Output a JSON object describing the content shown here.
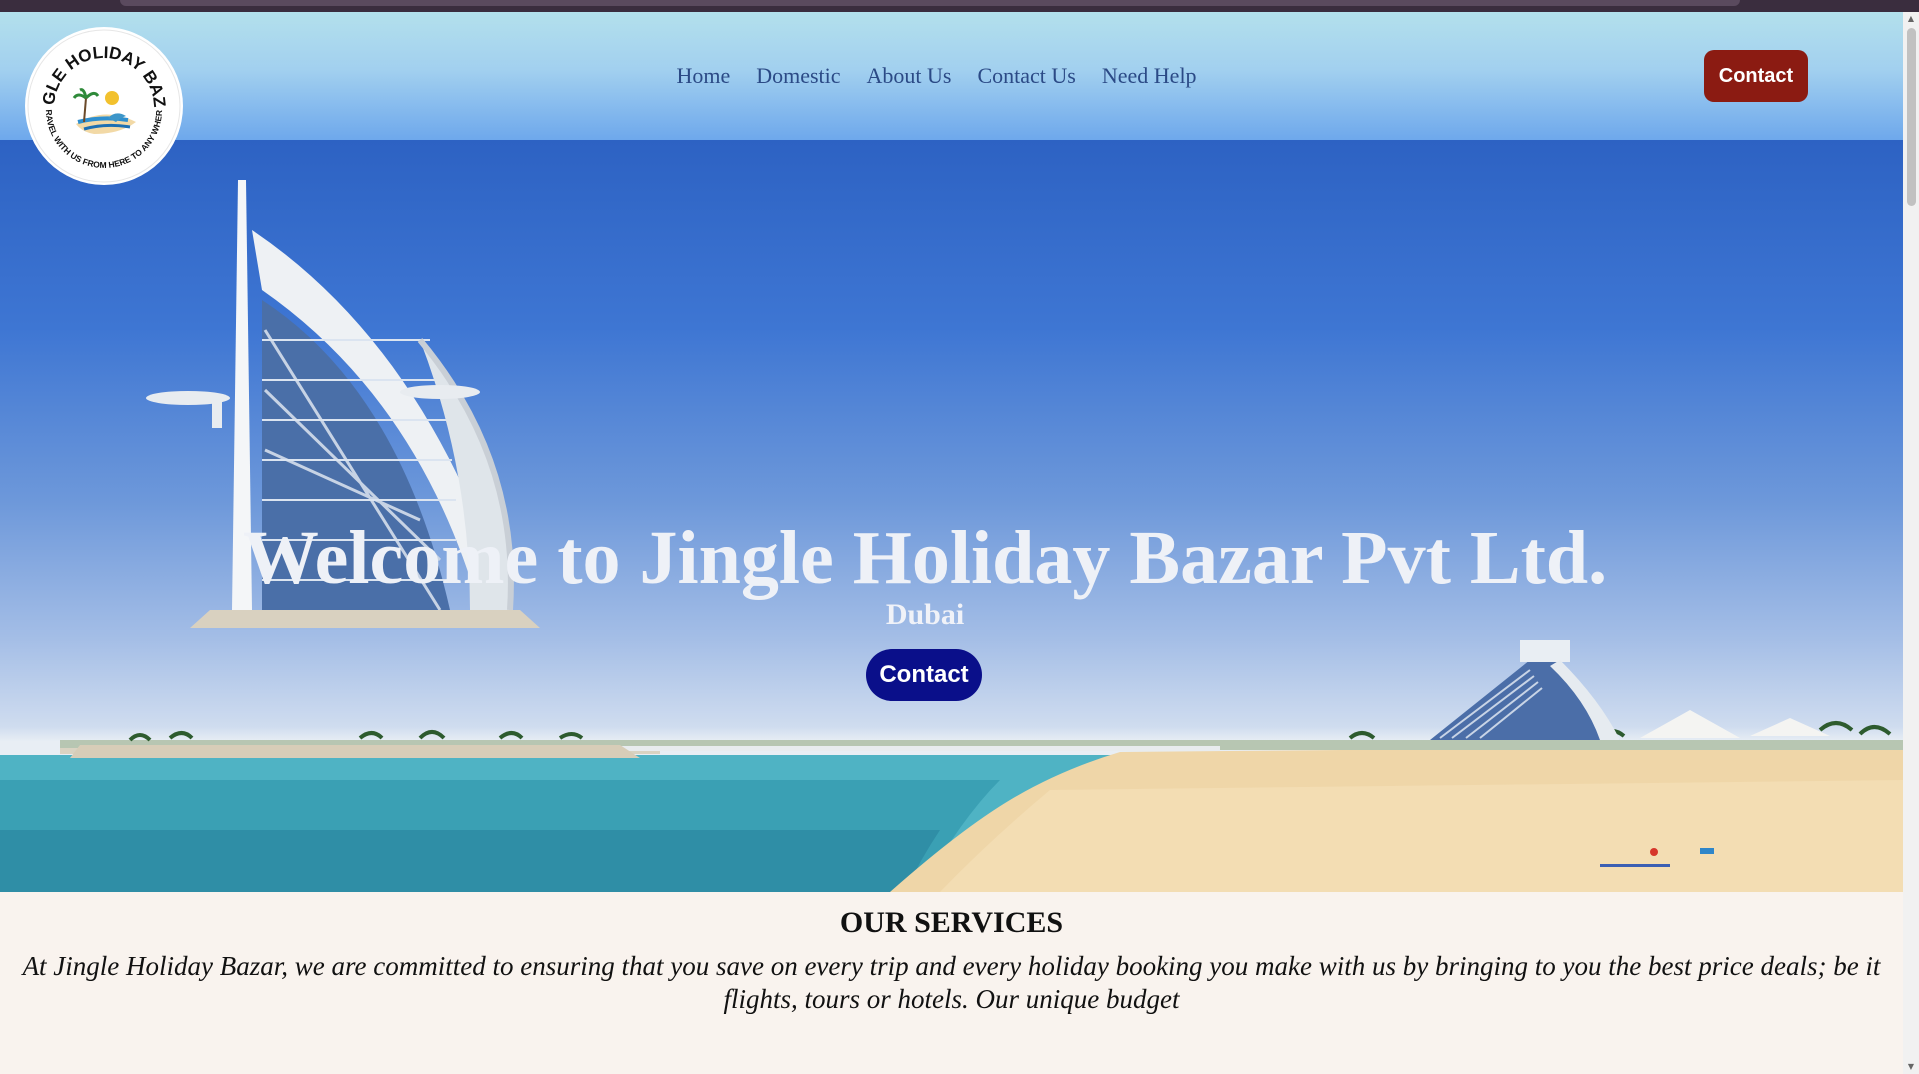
{
  "logo": {
    "arc_top": "JINGLE HOLIDAY BAZAR",
    "arc_bottom": "TRAVEL WITH US FROM HERE TO ANY WHERE"
  },
  "nav": {
    "items": [
      "Home",
      "Domestic",
      "About Us",
      "Contact Us",
      "Need Help"
    ],
    "cta": "Contact"
  },
  "hero": {
    "title": "Welcome to Jingle Holiday Bazar Pvt Ltd.",
    "subtitle": "Dubai",
    "button": "Contact"
  },
  "services": {
    "heading": "OUR SERVICES",
    "text": "At Jingle Holiday Bazar, we are committed to ensuring that you save on every trip and every holiday booking you make with us by bringing to you the best price deals; be it flights, tours or hotels. Our unique budget"
  },
  "colors": {
    "header_cta": "#8b1b12",
    "hero_cta": "#0a0f8a",
    "nav_text": "#2b4a86",
    "services_bg": "#f9f3ee"
  }
}
